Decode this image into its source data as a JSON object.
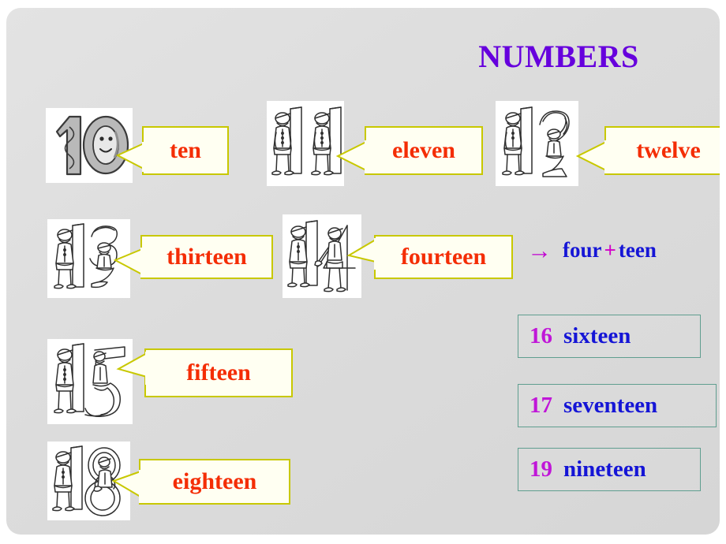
{
  "slide": {
    "title": "NUMBERS",
    "title_color": "#6600dd",
    "background_color": "#dcdcdc",
    "callout_text_color": "#f42d05",
    "callout_border_color": "#c8c800",
    "callout_fill_color": "#fffff2",
    "numbox_border_color": "#5f9e8f",
    "numbox_number_color": "#c016d8",
    "numbox_word_color": "#1515d6"
  },
  "callouts": [
    {
      "label": "ten",
      "number": "10",
      "icon": "number-10-clipart"
    },
    {
      "label": "eleven",
      "number": "11",
      "icon": "number-11-clipart"
    },
    {
      "label": "twelve",
      "number": "12",
      "icon": "number-12-clipart"
    },
    {
      "label": "thirteen",
      "number": "13",
      "icon": "number-13-clipart"
    },
    {
      "label": "fourteen",
      "number": "14",
      "icon": "number-14-clipart"
    },
    {
      "label": "fifteen",
      "number": "15",
      "icon": "number-15-clipart"
    },
    {
      "label": "eighteen",
      "number": "18",
      "icon": "number-18-clipart"
    }
  ],
  "equation": {
    "arrow": "→",
    "first": "four",
    "operator": "+",
    "second": "teen"
  },
  "number_boxes": [
    {
      "number": "16",
      "word": "sixteen"
    },
    {
      "number": "17",
      "word": "seventeen"
    },
    {
      "number": "19",
      "word": "nineteen"
    }
  ]
}
